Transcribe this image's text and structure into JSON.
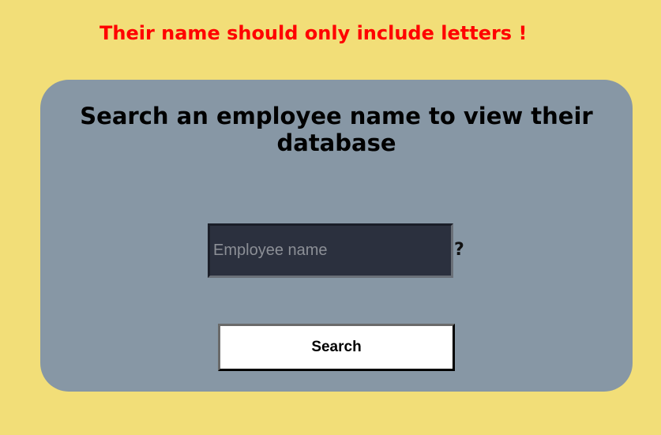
{
  "error": {
    "message": "Their name should only include letters !"
  },
  "search_card": {
    "title": "Search an employee name to view their database",
    "input": {
      "value": "",
      "placeholder": "Employee name"
    },
    "suffix": "?",
    "button_label": "Search"
  },
  "colors": {
    "background": "#f2de78",
    "card": "#8797a5",
    "error": "#ff0000",
    "input_background": "#2b303e",
    "button_background": "#ffffff"
  }
}
